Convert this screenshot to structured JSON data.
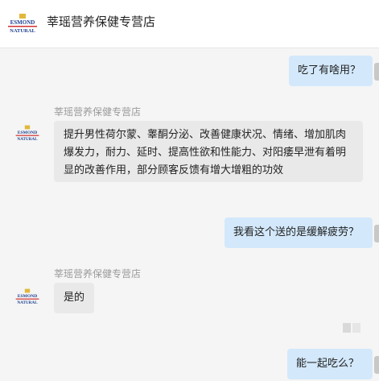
{
  "header": {
    "shop_name": "莘瑶营养保健专营店",
    "logo_text_top": "ESMOND",
    "logo_text_bottom": "NATURAL"
  },
  "messages": [
    {
      "from": "user",
      "text": "吃了有啥用？"
    },
    {
      "from": "shop",
      "sender": "莘瑶营养保健专营店",
      "lines": [
        "提升男性荷尔蒙、睾酮分泌、改善健康状况、情绪、增加肌肉",
        "爆发力，耐力、延时、提高性欲和性能力、对阳痿早泄有着明",
        "显的改善作用，部分顾客反馈有增大增粗的功效"
      ]
    },
    {
      "from": "user",
      "text": "我看这个送的是缓解疲劳？"
    },
    {
      "from": "shop",
      "sender": "莘瑶营养保健专营店",
      "text": "是的"
    },
    {
      "from": "user",
      "text": "能一起吃么？"
    }
  ],
  "colors": {
    "user_bubble": "#d3e8fb",
    "shop_bubble": "#e9e9e9",
    "sender_name": "#9a9a9a",
    "background": "#f5f5f5"
  }
}
